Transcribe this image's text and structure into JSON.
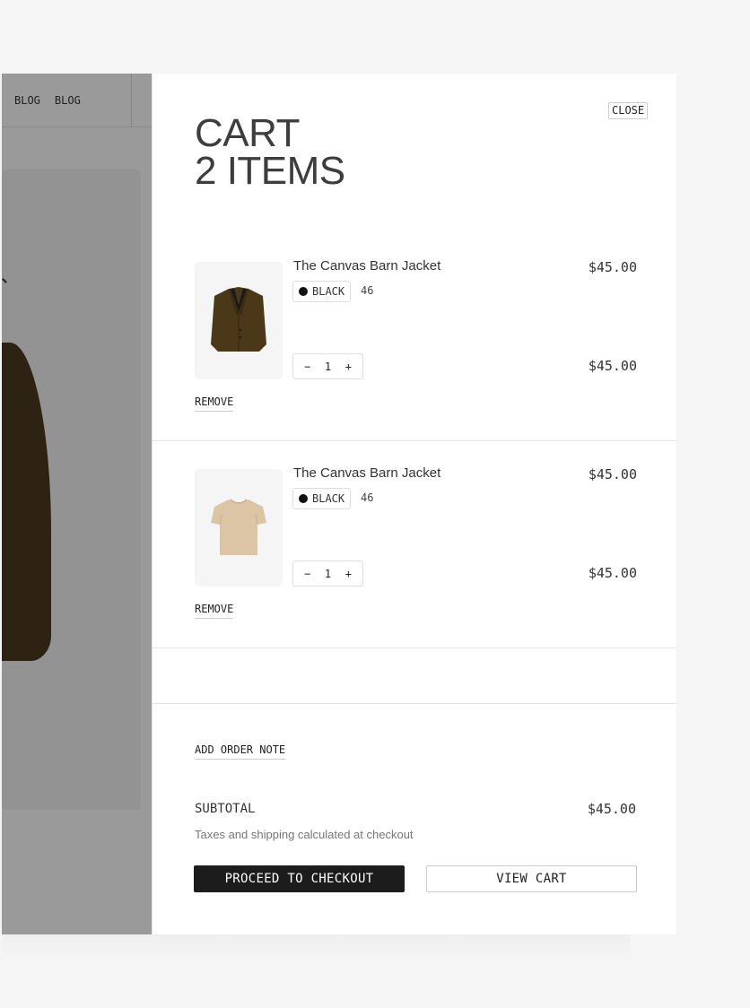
{
  "background": {
    "nav_items": [
      "BLOG",
      "BLOG"
    ]
  },
  "cart": {
    "close_label": "CLOSE",
    "title_line1": "CART",
    "title_line2": "2 ITEMS",
    "items": [
      {
        "name": "The Canvas Barn Jacket",
        "color": "BLACK",
        "size": "46",
        "unit_price": "$45.00",
        "line_price": "$45.00",
        "quantity": "1",
        "decrement": "−",
        "increment": "+",
        "remove_label": "REMOVE",
        "thumb_icon": "jacket-icon"
      },
      {
        "name": "The Canvas Barn Jacket",
        "color": "BLACK",
        "size": "46",
        "unit_price": "$45.00",
        "line_price": "$45.00",
        "quantity": "1",
        "decrement": "−",
        "increment": "+",
        "remove_label": "REMOVE",
        "thumb_icon": "tshirt-icon"
      }
    ],
    "order_note_label": "ADD ORDER NOTE",
    "subtotal_label": "SUBTOTAL",
    "subtotal_value": "$45.00",
    "taxes_note": "Taxes and shipping calculated at checkout",
    "checkout_label": "PROCEED TO CHECKOUT",
    "view_cart_label": "VIEW CART"
  },
  "colors": {
    "overlay": "#9a9a9a",
    "primary_button": "#1c1c1c",
    "swatch_black": "#111111"
  }
}
